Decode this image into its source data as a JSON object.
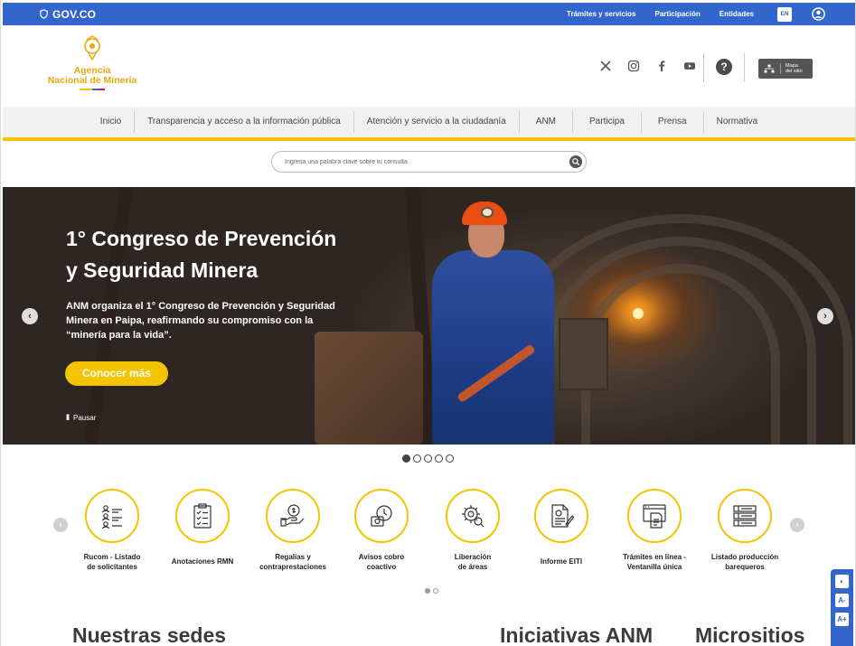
{
  "gov_bar": {
    "logo_text": "GOV.CO",
    "links": [
      "Trámites y servicios",
      "Participación",
      "Entidades"
    ],
    "lang": "EN"
  },
  "header": {
    "agency_line1": "Agencia",
    "agency_line2": "Nacional de Minería",
    "social_icons": [
      "x-icon",
      "instagram-icon",
      "facebook-icon",
      "youtube-icon"
    ],
    "help": "?",
    "sitemap_line1": "Mapa",
    "sitemap_line2": "del sitio"
  },
  "nav": {
    "items": [
      "Inicio",
      "Transparencia y acceso a la información pública",
      "Atención y servicio a la ciudadanía",
      "ANM",
      "Participa",
      "Prensa",
      "Normativa"
    ]
  },
  "search": {
    "placeholder": "Ingresa una palabra clave sobre tu consulta"
  },
  "hero": {
    "title_line1": "1° Congreso de Prevención",
    "title_line2": "y Seguridad Minera",
    "description": "ANM organiza el 1° Congreso de Prevención y Seguridad Minera en Paipa, reafirmando su compromiso con la “minería para la vida”.",
    "cta": "Conocer más",
    "pause": "Pausar",
    "prev": "‹",
    "next": "›",
    "slide_count": 5,
    "active_slide": 1
  },
  "services": {
    "items": [
      {
        "line1": "Rucom - Listado",
        "line2": "de solicitantes",
        "icon": "list-users-icon"
      },
      {
        "line1": "Anotaciones RMN",
        "line2": "",
        "icon": "clipboard-icon"
      },
      {
        "line1": "Regalías y",
        "line2": "contraprestaciones",
        "icon": "hand-coin-icon"
      },
      {
        "line1": "Avisos cobro",
        "line2": "coactivo",
        "icon": "coin-clock-icon"
      },
      {
        "line1": "Liberación",
        "line2": "de áreas",
        "icon": "gear-search-icon"
      },
      {
        "line1": "Informe EITI",
        "line2": "",
        "icon": "document-pen-icon"
      },
      {
        "line1": "Trámites en línea -",
        "line2": "Ventanilla única",
        "icon": "browser-doc-icon"
      },
      {
        "line1": "Listado producción",
        "line2": "barequeros",
        "icon": "checklist-icon"
      }
    ],
    "page_count": 2,
    "active_page": 1
  },
  "sections": {
    "sedes": "Nuestras sedes",
    "iniciativas": "Iniciativas ANM",
    "micrositios": "Micrositios"
  },
  "accessibility": {
    "contrast": "◐",
    "decrease": "A-",
    "increase": "A+"
  },
  "colors": {
    "gov_blue": "#3366cc",
    "accent_yellow": "#f5c400",
    "logo_gold": "#e7a90c"
  }
}
